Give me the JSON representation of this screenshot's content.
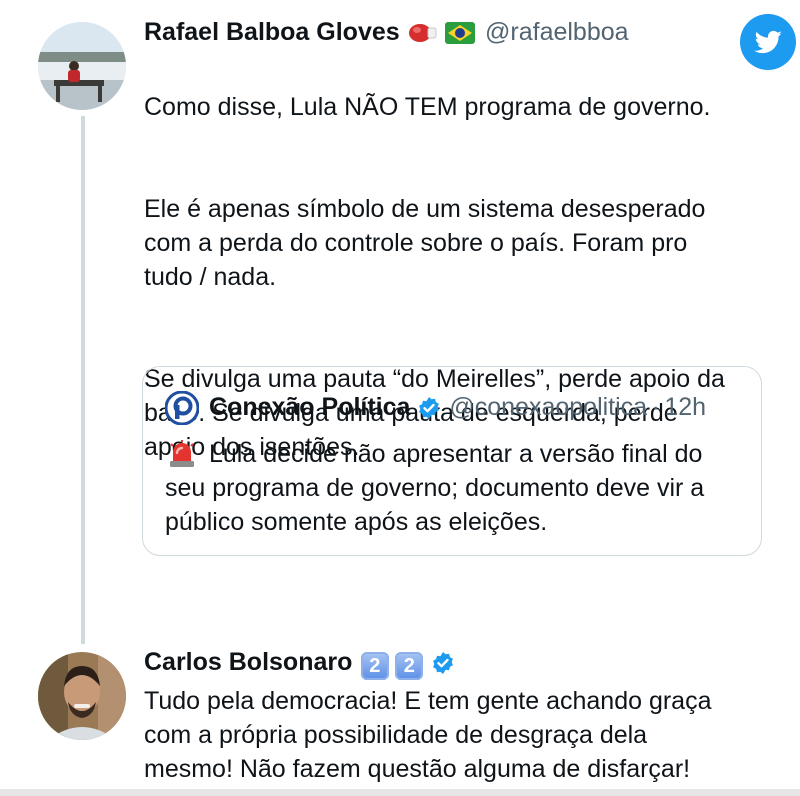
{
  "tweet": {
    "author_name": "Rafael Balboa Gloves",
    "author_handle": "@rafaelbboa",
    "paragraphs": [
      "Como disse, Lula NÃO TEM programa de governo.",
      "Ele é apenas símbolo de um sistema desesperado\ncom a perda do controle sobre o país. Foram pro\ntudo / nada.",
      "Se divulga uma pauta “do Meirelles”, perde apoio da\nbase. Se divulga uma pauta de esquerda, perde\napoio dos isentões."
    ]
  },
  "quote": {
    "author_name": "Conexão Política",
    "author_handle": "@conexaopolitica",
    "separator": "·",
    "time": "12h",
    "text": "Lula decide não apresentar a versão final do\nseu programa de governo; documento deve vir a\npúblico somente após as eleições."
  },
  "reply": {
    "author_name": "Carlos Bolsonaro",
    "badges": [
      "2",
      "2"
    ],
    "text": "Tudo pela democracia! E tem gente achando graça\ncom a própria possibilidade de desgraça dela\nmesmo! Não fazem questão alguma de disfarçar!"
  },
  "icons": {
    "twitter_logo": "twitter-bird-icon",
    "verified": "verified-badge-icon",
    "boxing_glove": "boxing-glove-icon",
    "brazil_flag": "brazil-flag-icon",
    "siren": "police-light-icon",
    "quote_logo": "conexao-politica-logo"
  },
  "colors": {
    "twitter_blue": "#1d9bf0",
    "text_primary": "#0f1419",
    "text_secondary": "#536471",
    "border": "#cfd9de"
  }
}
